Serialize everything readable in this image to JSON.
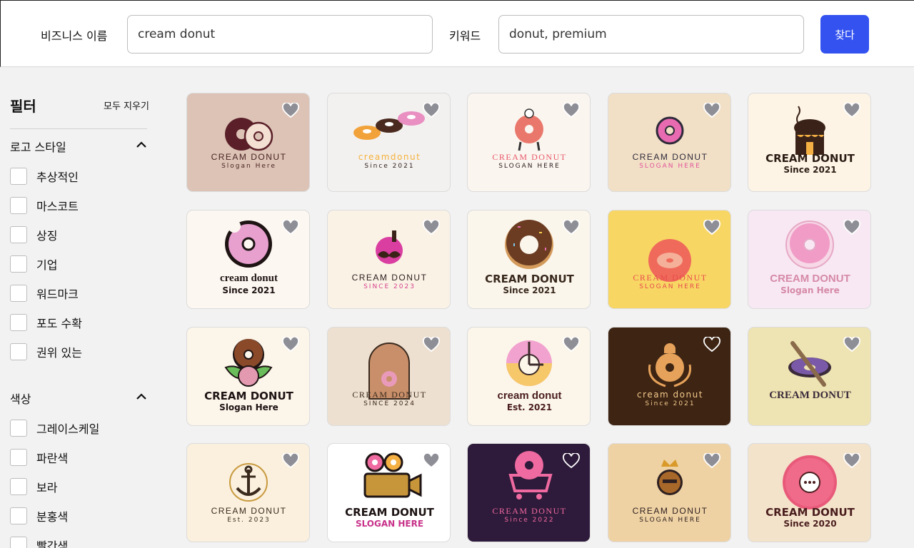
{
  "header": {
    "business_label": "비즈니스 이름",
    "business_value": "cream donut",
    "keyword_label": "키워드",
    "keyword_value": "donut, premium",
    "find_label": "찾다"
  },
  "sidebar": {
    "title": "필터",
    "clear_all": "모두 지우기",
    "logo_style": {
      "title": "로고 스타일",
      "options": [
        "추상적인",
        "마스코트",
        "상징",
        "기업",
        "워드마크",
        "포도 수확",
        "권위 있는"
      ]
    },
    "color": {
      "title": "색상",
      "options": [
        "그레이스케일",
        "파란색",
        "보라",
        "분홍색",
        "빨간색"
      ]
    }
  },
  "colors": {
    "accent": "#3352f0"
  },
  "cards": [
    {
      "bg": "#dcc3b6",
      "brand": "CREAM DONUT",
      "tag": "Slogan Here",
      "brand_color": "#4a2323",
      "tag_color": "#4a2323",
      "icon": "two-donuts-icon",
      "heart": "gray"
    },
    {
      "bg": "#f3f1ef",
      "brand": "creamdonut",
      "tag": "Since 2021",
      "brand_color": "#f5b23d",
      "tag_color": "#2e2020",
      "icon": "three-donuts-icon",
      "heart": "gray"
    },
    {
      "bg": "#fbf5ef",
      "brand": "CREAM DONUT",
      "tag": "SLOGAN HERE",
      "brand_color": "#e85a6a",
      "tag_color": "#2e2020",
      "icon": "donut-mascot-icon",
      "heart": "gray"
    },
    {
      "bg": "#f1dfc6",
      "brand": "CREAM DONUT",
      "tag": "SLOGAN HERE",
      "brand_color": "#2e2a3a",
      "tag_color": "#e3559a",
      "icon": "small-donut-icon",
      "heart": "gray"
    },
    {
      "bg": "#fdf4e6",
      "brand": "CREAM DONUT",
      "tag": "Since 2021",
      "brand_color": "#2c1d14",
      "tag_color": "#2c1d14",
      "icon": "donut-house-icon",
      "heart": "gray"
    },
    {
      "bg": "#fcf7f0",
      "brand": "cream donut",
      "tag": "Since 2021",
      "brand_color": "#1e1414",
      "tag_color": "#1e1414",
      "icon": "bitten-donut-icon",
      "heart": "gray"
    },
    {
      "bg": "#fbf2e6",
      "brand": "CREAM DONUT",
      "tag": "SINCE 2023",
      "brand_color": "#2e2020",
      "tag_color": "#d4448d",
      "icon": "mustache-donut-icon",
      "heart": "gray"
    },
    {
      "bg": "#fbf6ec",
      "brand": "CREAM DONUT",
      "tag": "Since 2021",
      "brand_color": "#3a2a1e",
      "tag_color": "#3a2a1e",
      "icon": "chocolate-donut-icon",
      "heart": "gray"
    },
    {
      "bg": "#f8d664",
      "brand": "CREAM DONUT",
      "tag": "SLOGAN HERE",
      "brand_color": "#e74c4c",
      "tag_color": "#e74c4c",
      "icon": "circle-badge-icon",
      "heart": "gray"
    },
    {
      "bg": "#f8e8f3",
      "brand": "CREAM DONUT",
      "tag": "Slogan Here",
      "brand_color": "#d68aa8",
      "tag_color": "#d68aa8",
      "icon": "pink-donut-icon",
      "heart": "gray"
    },
    {
      "bg": "#fcf5ea",
      "brand": "CREAM DONUT",
      "tag": "Slogan Here",
      "brand_color": "#1e1414",
      "tag_color": "#1e1414",
      "icon": "leaf-donut-icon",
      "heart": "gray"
    },
    {
      "bg": "#eee0d0",
      "brand": "CREAM DONUT",
      "tag": "SINCE 2024",
      "brand_color": "#3a2a1e",
      "tag_color": "#3a2a1e",
      "icon": "arch-badge-icon",
      "heart": "gray"
    },
    {
      "bg": "#fcf6ea",
      "brand": "cream donut",
      "tag": "Est. 2021",
      "brand_color": "#4a1e1e",
      "tag_color": "#4a1e1e",
      "icon": "clock-donut-icon",
      "heart": "gray"
    },
    {
      "bg": "#3d2413",
      "brand": "cream donut",
      "tag": "Since 2021",
      "brand_color": "#f3c98c",
      "tag_color": "#f3c98c",
      "icon": "wreath-donut-icon",
      "heart": "white"
    },
    {
      "bg": "#eee3b2",
      "brand": "CREAM DONUT",
      "tag": "",
      "brand_color": "#3a2a3a",
      "tag_color": "#3a2a3a",
      "icon": "rolling-pin-donut-icon",
      "heart": "gray"
    },
    {
      "bg": "#fbf0dd",
      "brand": "CREAM DONUT",
      "tag": "Est. 2023",
      "brand_color": "#3a2a1e",
      "tag_color": "#3a2a1e",
      "icon": "anchor-icon",
      "heart": "gray"
    },
    {
      "bg": "#ffffff",
      "brand": "CREAM DONUT",
      "tag": "SLOGAN HERE",
      "brand_color": "#1e1414",
      "tag_color": "#c8328a",
      "icon": "camera-donut-icon",
      "heart": "gray"
    },
    {
      "bg": "#2e1a3a",
      "brand": "CREAM DONUT",
      "tag": "Since 2022",
      "brand_color": "#ef6aa0",
      "tag_color": "#ef6aa0",
      "icon": "cart-donut-icon",
      "heart": "white"
    },
    {
      "bg": "#efd2a4",
      "brand": "CREAM DONUT",
      "tag": "SLOGAN HERE",
      "brand_color": "#2e2020",
      "tag_color": "#2e2020",
      "icon": "crown-donut-icon",
      "heart": "gray"
    },
    {
      "bg": "#f4e3cb",
      "brand": "CREAM DONUT",
      "tag": "Since 2020",
      "brand_color": "#4a1e1e",
      "tag_color": "#4a1e1e",
      "icon": "speech-donut-icon",
      "heart": "gray"
    }
  ]
}
